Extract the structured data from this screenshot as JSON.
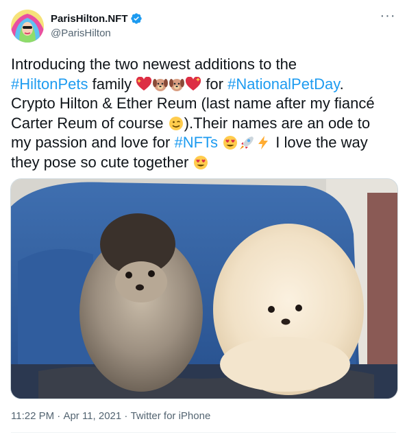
{
  "author": {
    "display_name": "ParisHilton.NFT",
    "handle": "@ParisHilton",
    "verified": true
  },
  "more_icon": "more-horizontal-icon",
  "tweet": {
    "line1": "Introducing the two newest additions to the",
    "hashtag_pets": "#HiltonPets",
    "family": " family ",
    "for": " for ",
    "hashtag_petday": "#NationalPetDay",
    "after_petday": ".",
    "line3": "Crypto Hilton & Ether Reum (last name after my fiancé",
    "line4": "Carter Reum of course ",
    "after_wink": ").Their names are an ode to",
    "line5": "my passion and love for ",
    "hashtag_nfts": "#NFTs",
    "after_emojis": " I love the way",
    "line6": "they pose so cute together "
  },
  "emojis": [
    "sparkling-heart",
    "dog-face",
    "dog-face",
    "sparkling-heart",
    "winking-face",
    "heart-eyes-face",
    "rocket",
    "high-voltage",
    "heart-eyes-face"
  ],
  "media": {
    "alt": "two pomeranian puppies on a blue armchair"
  },
  "meta": {
    "time": "11:22 PM",
    "sep1": " · ",
    "date": "Apr 11, 2021",
    "sep2": " · ",
    "client": "Twitter for iPhone"
  },
  "colors": {
    "link": "#1d9bf0",
    "verified": "#1d9bf0",
    "secondary": "#536471"
  }
}
